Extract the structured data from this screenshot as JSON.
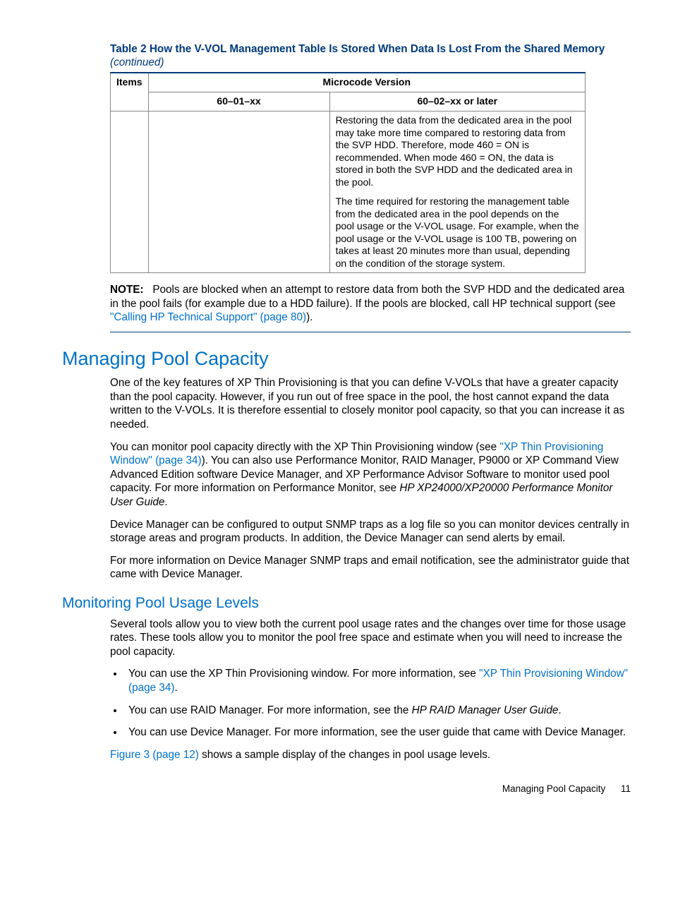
{
  "table": {
    "caption_prefix": "Table 2 How the V-VOL Management Table Is Stored When Data Is Lost From the Shared Memory ",
    "caption_suffix": "(continued)",
    "head_items": "Items",
    "head_micro": "Microcode Version",
    "head_v1": "60–01–xx",
    "head_v2": "60–02–xx or later",
    "cell_p1": "Restoring the data from the dedicated area in the pool may take more time compared to restoring data from the SVP HDD. Therefore, mode 460 = ON is recommended. When mode 460 = ON, the data is stored in both the SVP HDD and the dedicated area in the pool.",
    "cell_p2": "The time required for restoring the management table from the dedicated area in the pool depends on the pool usage or the V-VOL usage. For example, when the pool usage or the V-VOL usage is 100 TB, powering on takes at least 20 minutes more than usual, depending on the condition of the storage system."
  },
  "note": {
    "label": "NOTE:",
    "text_before": "Pools are blocked when an attempt to restore data from both the SVP HDD and the dedicated area in the pool fails (for example due to a HDD failure). If the pools are blocked, call HP technical support (see ",
    "link": "\"Calling HP Technical Support\" (page 80)",
    "text_after": ")."
  },
  "h1": "Managing Pool Capacity",
  "p1": "One of the key features of XP Thin Provisioning is that you can define V-VOLs that have a greater capacity than the pool capacity. However, if you run out of free space in the pool, the host cannot expand the data written to the V-VOLs. It is therefore essential to closely monitor pool capacity, so that you can increase it as needed.",
  "p2a": "You can monitor pool capacity directly with the XP Thin Provisioning window (see ",
  "p2link": "\"XP Thin Provisioning Window\" (page 34)",
  "p2b": "). You can also use Performance Monitor, RAID Manager, P9000 or XP Command View Advanced Edition software Device Manager, and XP Performance Advisor Software to monitor used pool capacity. For more information on Performance Monitor, see ",
  "p2italic": "HP XP24000/XP20000 Performance Monitor User Guide",
  "p2c": ".",
  "p3": "Device Manager can be configured to output SNMP traps as a log file so you can monitor devices centrally in storage areas and program products. In addition, the Device Manager can send alerts by email.",
  "p4": "For more information on Device Manager SNMP traps and email notification, see the administrator guide that came with Device Manager.",
  "h2": "Monitoring Pool Usage Levels",
  "p5": "Several tools allow you to view both the current pool usage rates and the changes over time for those usage rates. These tools allow you to monitor the pool free space and estimate when you will need to increase the pool capacity.",
  "li1a": "You can use the XP Thin Provisioning window. For more information, see ",
  "li1link": "\"XP Thin Provisioning Window\" (page 34)",
  "li1b": ".",
  "li2a": "You can use RAID Manager. For more information, see the ",
  "li2italic": "HP RAID Manager User Guide",
  "li2b": ".",
  "li3": "You can use Device Manager. For more information, see the user guide that came with Device Manager.",
  "p6a": "",
  "p6link": "Figure 3 (page 12)",
  "p6b": " shows a sample display of the changes in pool usage levels.",
  "footer": {
    "title": "Managing Pool Capacity",
    "page": "11"
  }
}
